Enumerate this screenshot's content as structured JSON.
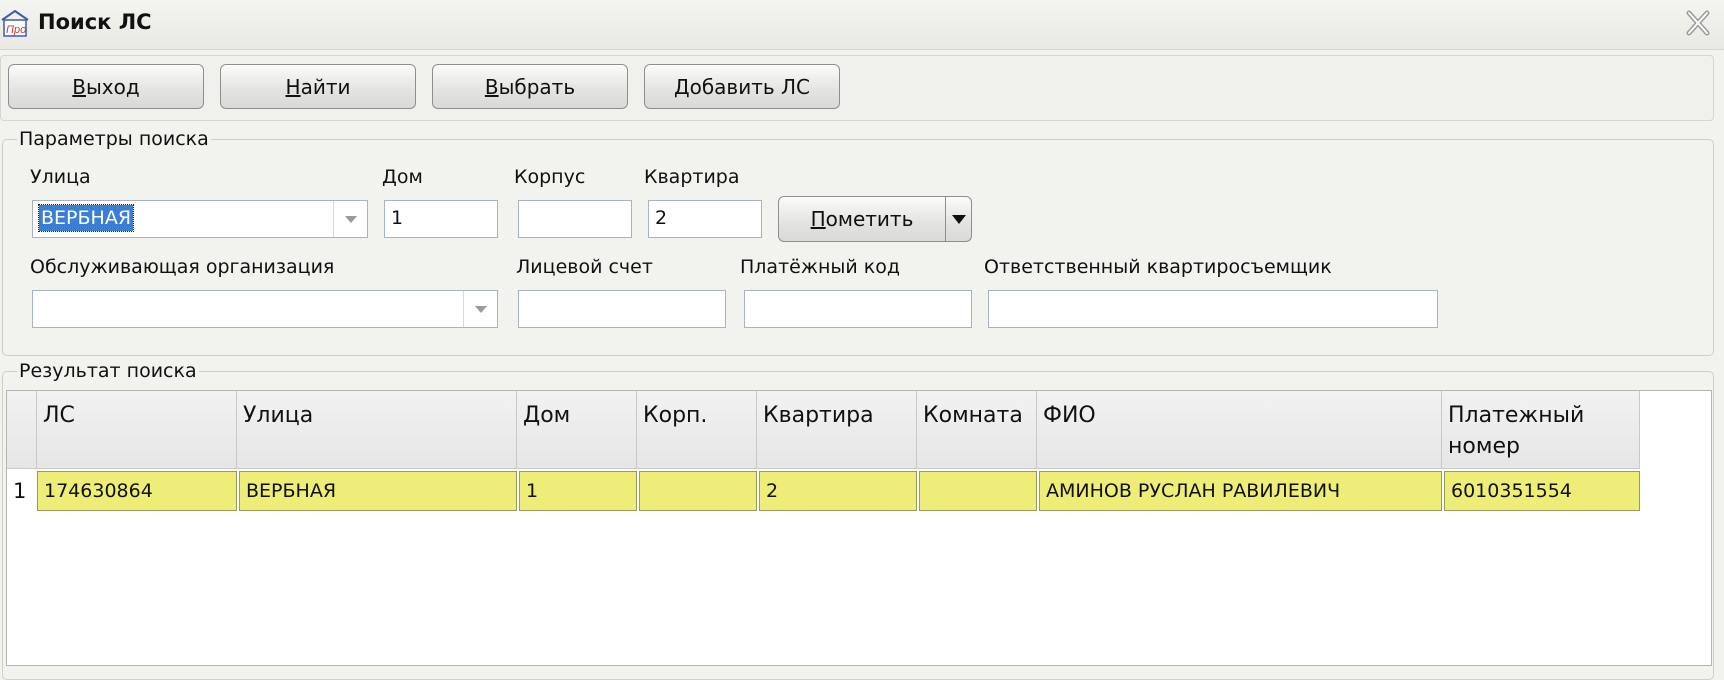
{
  "window": {
    "title": "Поиск ЛС"
  },
  "toolbar": {
    "exit_first": "В",
    "exit_rest": "ыход",
    "find_first": "Н",
    "find_rest": "айти",
    "select_first": "В",
    "select_rest": "ыбрать",
    "add_label": "Добавить ЛС"
  },
  "search_params": {
    "legend": "Параметры поиска",
    "street_label": "Улица",
    "street_value": "ВЕРБНАЯ",
    "house_label": "Дом",
    "house_value": "1",
    "building_label": "Корпус",
    "building_value": "",
    "apartment_label": "Квартира",
    "apartment_value": "2",
    "mark_first": "П",
    "mark_rest": "ометить",
    "org_label": "Обслуживающая организация",
    "org_value": "",
    "account_label": "Лицевой счет",
    "account_value": "",
    "payment_code_label": "Платёжный код",
    "payment_code_value": "",
    "tenant_label": "Ответственный квартиросъемщик",
    "tenant_value": ""
  },
  "results": {
    "legend": "Результат поиска",
    "columns": [
      "ЛС",
      "Улица",
      "Дом",
      "Корп.",
      "Квартира",
      "Комната",
      "ФИО",
      "Платежный номер"
    ],
    "rows": [
      {
        "num": "1",
        "cells": [
          "174630864",
          "ВЕРБНАЯ",
          "1",
          "",
          "2",
          "",
          "АМИНОВ РУСЛАН РАВИЛЕВИЧ",
          "6010351554"
        ]
      }
    ]
  },
  "icons": {
    "app": "app-logo-icon",
    "close": "close-icon"
  }
}
